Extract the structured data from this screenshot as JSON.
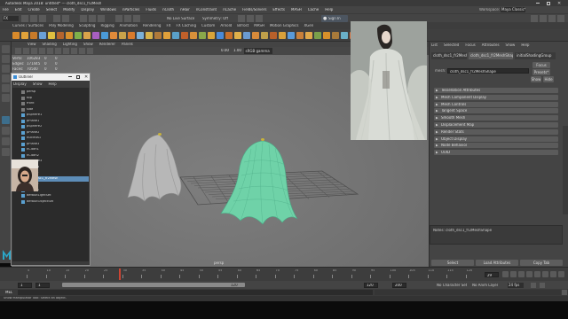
{
  "app": {
    "title": "Autodesk Maya 2018: untitled* --- cloth_dsc1_fr2Mesh",
    "workspace_label": "Workspace:",
    "workspace_value": "Maya Classic*",
    "sign_in": "Sign In"
  },
  "menus": [
    "File",
    "Edit",
    "Create",
    "Select",
    "Modify",
    "Display",
    "Windows",
    "nParticles",
    "Fluids",
    "nCloth",
    "nHair",
    "nConstraint",
    "nCache",
    "Fields/Solvers",
    "Effects",
    "MASH",
    "Cache",
    "Help"
  ],
  "status": {
    "mode": "FX",
    "live_surface": "No Live Surface",
    "symmetry": "Symmetry: Off"
  },
  "shelf_tabs": [
    "Curves / Surfaces",
    "Poly Modeling",
    "Sculpting",
    "Rigging",
    "Animation",
    "Rendering",
    "FX",
    "FX Caching",
    "Custom",
    "Arnold",
    "Bifrost",
    "MASH",
    "Motion Graphics",
    "XGen"
  ],
  "viewport": {
    "menus": [
      "View",
      "Shading",
      "Lighting",
      "Show",
      "Renderer",
      "Panels"
    ],
    "hud": {
      "rows": [
        {
          "label": "Verts:",
          "v1": "106283",
          "v2": "0",
          "v3": "0"
        },
        {
          "label": "Edges:",
          "v1": "171445",
          "v2": "0",
          "v3": "0"
        },
        {
          "label": "Faces:",
          "v1": "70500",
          "v2": "0",
          "v3": "0"
        },
        {
          "label": "Tris:",
          "v1": "131602",
          "v2": "0",
          "v3": "0"
        },
        {
          "label": "UVs:",
          "v1": "113100",
          "v2": "0",
          "v3": "0"
        }
      ]
    },
    "gamma": "sRGB gamma",
    "camera_label": "persp",
    "exposure": "0.00",
    "gamma_val": "1.00"
  },
  "outliner": {
    "title": "Outliner",
    "menus": [
      "Display",
      "Show",
      "Help"
    ],
    "search_placeholder": "",
    "items": [
      "persp",
      "top",
      "front",
      "side",
      "pSphere1",
      "pPlane1",
      "pSphere2",
      "pPlane2",
      "nucleus1",
      "pPlane3",
      "nCloth1",
      "nCloth2",
      "pSphere3",
      "pPlane4",
      "nRigid1",
      "cloth_dsc1_fr2Mesh",
      "nRigid2",
      "nRigid3",
      "defaultLightSet",
      "defaultObjectSet"
    ],
    "selected_index": 15
  },
  "attribute_editor": {
    "tabs": [
      "List",
      "Selected",
      "Focus",
      "Attributes",
      "Show",
      "Help"
    ],
    "node_tabs": [
      "cloth_dsc1_fr2Mesh",
      "cloth_dsc1_fr2MeshShape",
      "initialShadingGroup"
    ],
    "shape_label": "mesh:",
    "shape_value": "cloth_dsc1_fr2MeshShape",
    "focus_btn": "Focus",
    "presets_btn": "Presets*",
    "show_btn": "Show",
    "hide_btn": "Hide",
    "sections": [
      "Tessellation Attributes",
      "Mesh Component Display",
      "Mesh Controls",
      "Tangent Space",
      "Smooth Mesh",
      "Displacement Map",
      "Render Stats",
      "Object Display",
      "Node Behavior",
      "UUID"
    ],
    "notes": "Notes: cloth_dsc1_fr2MeshShape",
    "buttons": [
      "Select",
      "Load Attributes",
      "Copy Tab"
    ]
  },
  "timeline": {
    "ticks": [
      "5",
      "10",
      "15",
      "20",
      "25",
      "30",
      "35",
      "40",
      "45",
      "50",
      "55",
      "60",
      "65",
      "70",
      "75",
      "80",
      "85",
      "90",
      "95",
      "100",
      "105",
      "110",
      "115",
      "120"
    ],
    "current_frame": "29",
    "range_start": "1",
    "range_inner_start": "1",
    "range_inner_end": "120",
    "range_end": "120",
    "playback_end": "200",
    "char_set": "No Character Set",
    "anim_layer": "No Anim Layer",
    "fps": "24 fps"
  },
  "command_line": {
    "label": "MEL",
    "help": "Show Manipulator Tool: Select an object."
  },
  "colors": {
    "cloth_selected": "#6fd2a8",
    "cloth_default": "#b9b9b9",
    "maya_logo": "#2aa7c9"
  }
}
